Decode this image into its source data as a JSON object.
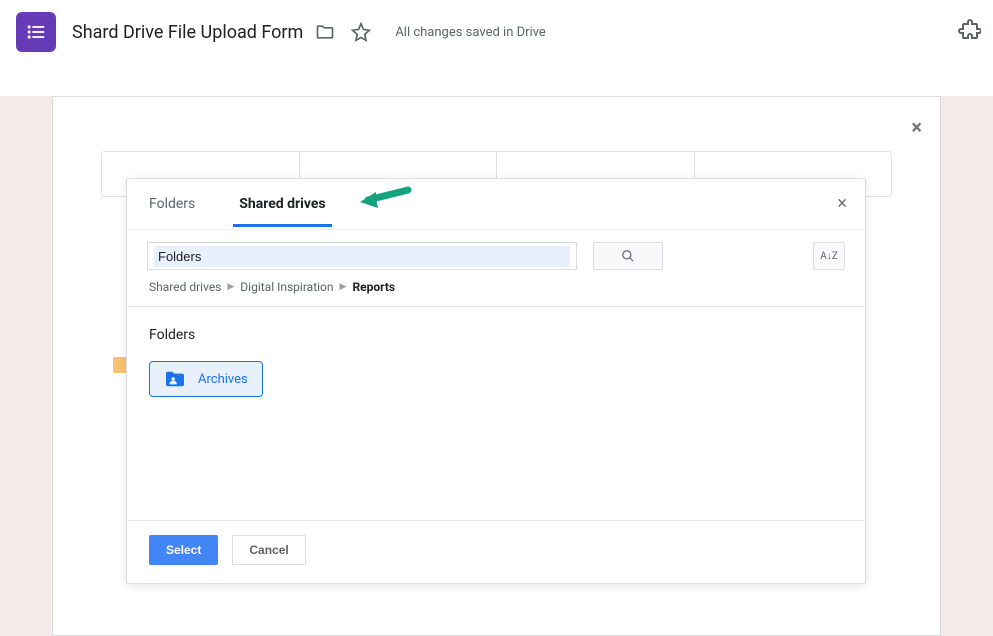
{
  "header": {
    "title": "Shard Drive File Upload Form",
    "saveStatus": "All changes saved in Drive"
  },
  "picker": {
    "tabs": {
      "folders": "Folders",
      "sharedDrives": "Shared drives"
    },
    "search": {
      "value": "Folders"
    },
    "breadcrumb": {
      "root": "Shared drives",
      "level1": "Digital Inspiration",
      "current": "Reports"
    },
    "sectionLabel": "Folders",
    "folder": {
      "name": "Archives"
    },
    "buttons": {
      "select": "Select",
      "cancel": "Cancel"
    }
  }
}
